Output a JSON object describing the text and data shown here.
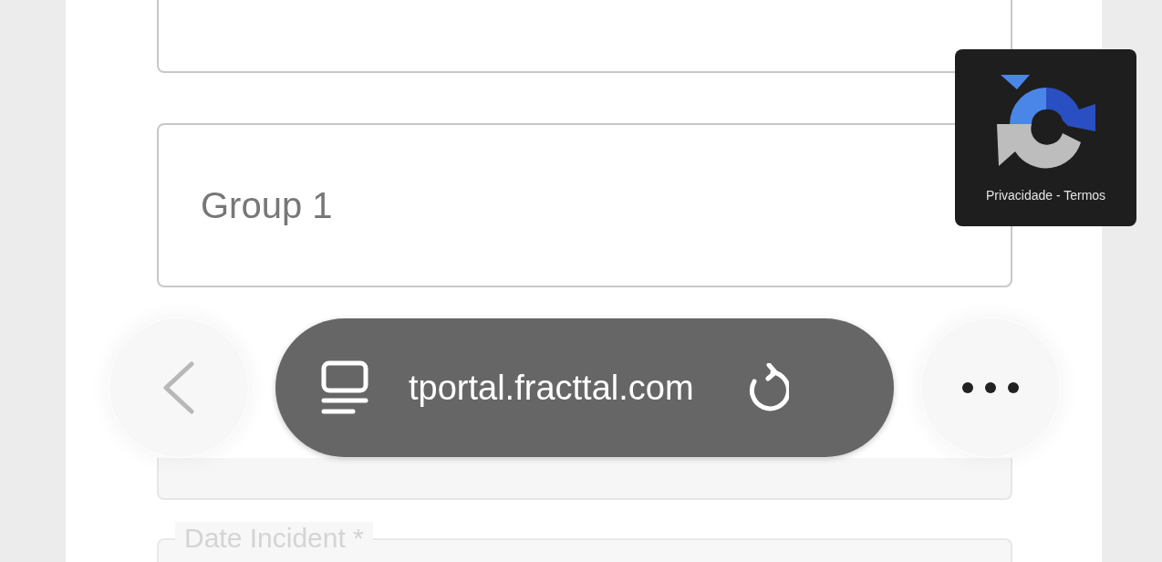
{
  "form": {
    "fields": [
      {
        "kind": "blank"
      },
      {
        "kind": "select",
        "value": "Group 1"
      },
      {
        "kind": "blank"
      },
      {
        "kind": "outlined",
        "label": "Date Incident *"
      }
    ]
  },
  "browser_toolbar": {
    "url": "tportal.fracttal.com"
  },
  "recaptcha": {
    "links": "Privacidade - Termos"
  }
}
